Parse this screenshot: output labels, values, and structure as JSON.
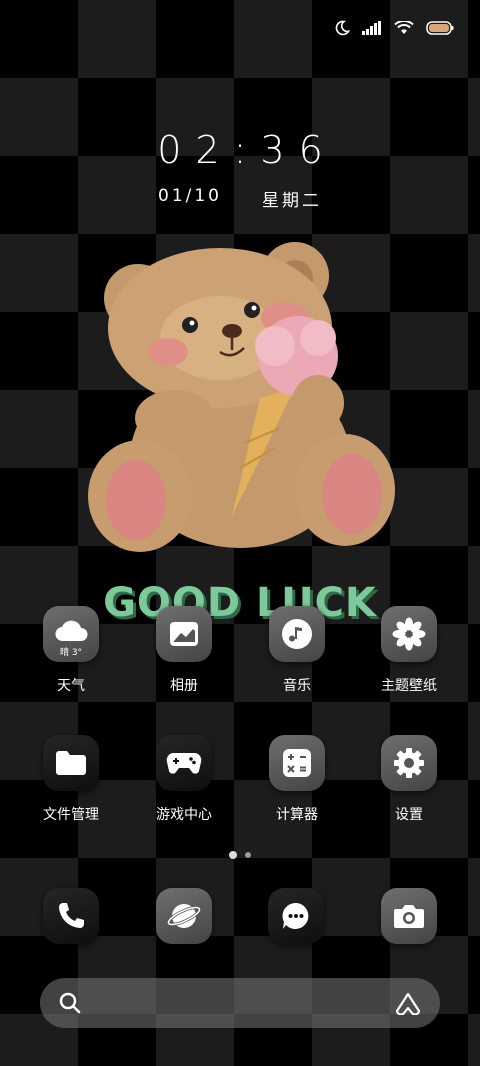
{
  "status_bar": {
    "icons": [
      "moon-icon",
      "signal-icon",
      "wifi-icon",
      "battery-icon"
    ]
  },
  "lockscreen": {
    "time": "02:36",
    "date": "01/10",
    "weekday": "星期二"
  },
  "wallpaper": {
    "text": "GOOD LUCK"
  },
  "apps": [
    {
      "label": "天气",
      "icon": "weather-cloud-icon",
      "sub": "晴 3°"
    },
    {
      "label": "相册",
      "icon": "gallery-icon"
    },
    {
      "label": "音乐",
      "icon": "music-icon"
    },
    {
      "label": "主题壁纸",
      "icon": "themes-flower-icon"
    },
    {
      "label": "文件管理",
      "icon": "folder-icon"
    },
    {
      "label": "游戏中心",
      "icon": "gamepad-icon"
    },
    {
      "label": "计算器",
      "icon": "calculator-icon"
    },
    {
      "label": "设置",
      "icon": "gear-icon"
    }
  ],
  "page_indicator": {
    "count": 2,
    "active": 0
  },
  "dock": [
    {
      "icon": "phone-icon"
    },
    {
      "icon": "browser-planet-icon"
    },
    {
      "icon": "messages-icon"
    },
    {
      "icon": "camera-icon"
    }
  ],
  "search_bar": {
    "left_icon": "search-icon",
    "right_icon": "assistant-icon"
  },
  "colors": {
    "good_luck_text": "#7dc99a",
    "good_luck_shadow": "#2f6b48"
  }
}
